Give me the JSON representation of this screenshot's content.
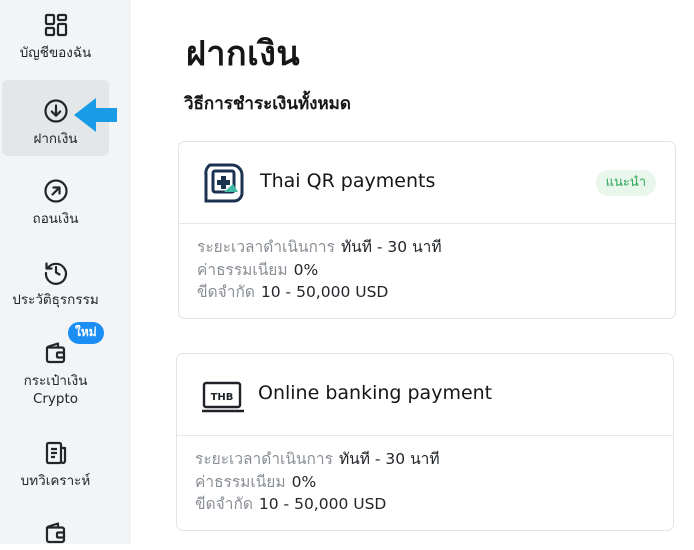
{
  "sidebar": {
    "items": [
      {
        "label": "บัญชีของฉัน",
        "icon": "dashboard-grid-icon"
      },
      {
        "label": "ฝากเงิน",
        "icon": "arrow-down-circle-icon",
        "active": true
      },
      {
        "label": "ถอนเงิน",
        "icon": "arrow-up-right-circle-icon"
      },
      {
        "label": "ประวัติธุรกรรม",
        "icon": "history-clock-icon"
      },
      {
        "label": "กระเป๋าเงิน Crypto",
        "icon": "wallet-icon",
        "badge": "ใหม่"
      },
      {
        "label": "บทวิเคราะห์",
        "icon": "analytics-document-icon"
      },
      {
        "label": "",
        "icon": "wallet-icon"
      }
    ],
    "badge_color": "#1a8ef5",
    "pointer_color": "#1a9be8"
  },
  "main": {
    "title": "ฝากเงิน",
    "subtitle": "วิธีการชำระเงินทั้งหมด",
    "methods": [
      {
        "name": "Thai QR payments",
        "icon": "thai-qr-icon",
        "badge": "แนะนำ",
        "processing_label": "ระยะเวลาดำเนินการ",
        "processing_value": "ทันที - 30 นาที",
        "fee_label": "ค่าธรรมเนียม",
        "fee_value": "0%",
        "limit_label": "ขีดจำกัด",
        "limit_value": "10 - 50,000 USD"
      },
      {
        "name": "Online banking payment",
        "icon": "thb-bank-card-icon",
        "icon_text": "THB",
        "processing_label": "ระยะเวลาดำเนินการ",
        "processing_value": "ทันที - 30 นาที",
        "fee_label": "ค่าธรรมเนียม",
        "fee_value": "0%",
        "limit_label": "ขีดจำกัด",
        "limit_value": "10 - 50,000 USD"
      }
    ]
  }
}
